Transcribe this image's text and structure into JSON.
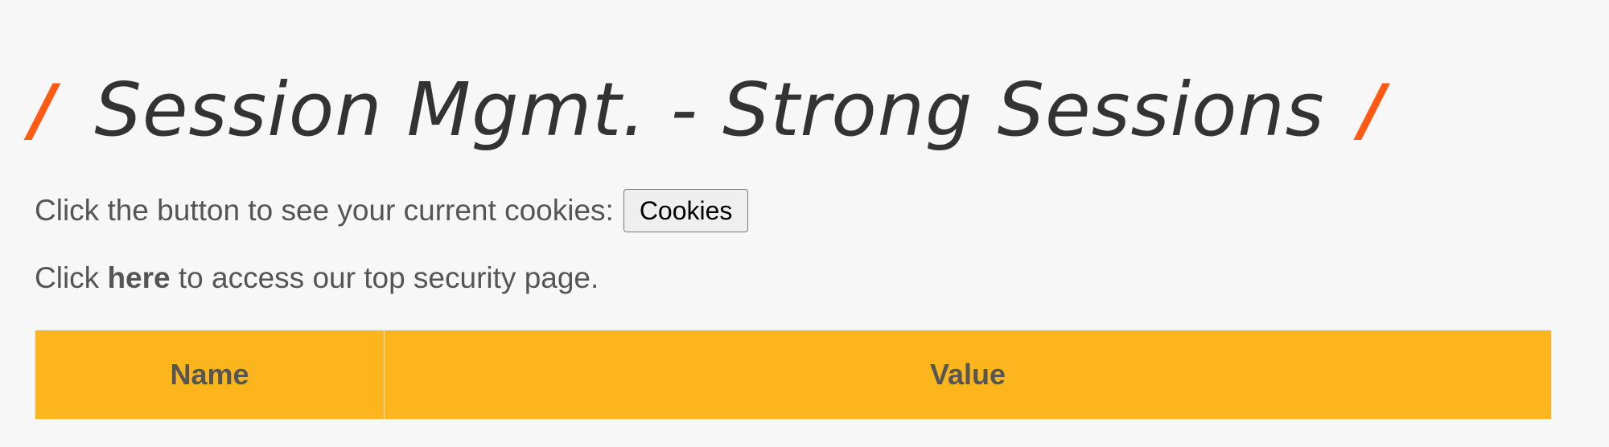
{
  "header": {
    "left_slash": "/",
    "title": "Session Mgmt. - Strong Sessions",
    "right_slash": "/"
  },
  "cookies_prompt": {
    "text": "Click the button to see your current cookies:",
    "button_label": "Cookies"
  },
  "security_line": {
    "prefix": "Click ",
    "link_text": "here",
    "suffix": " to access our top security page."
  },
  "table": {
    "columns": [
      "Name",
      "Value"
    ]
  },
  "colors": {
    "accent_slash": "#ff5a14",
    "table_header_bg": "#fdb51e"
  }
}
